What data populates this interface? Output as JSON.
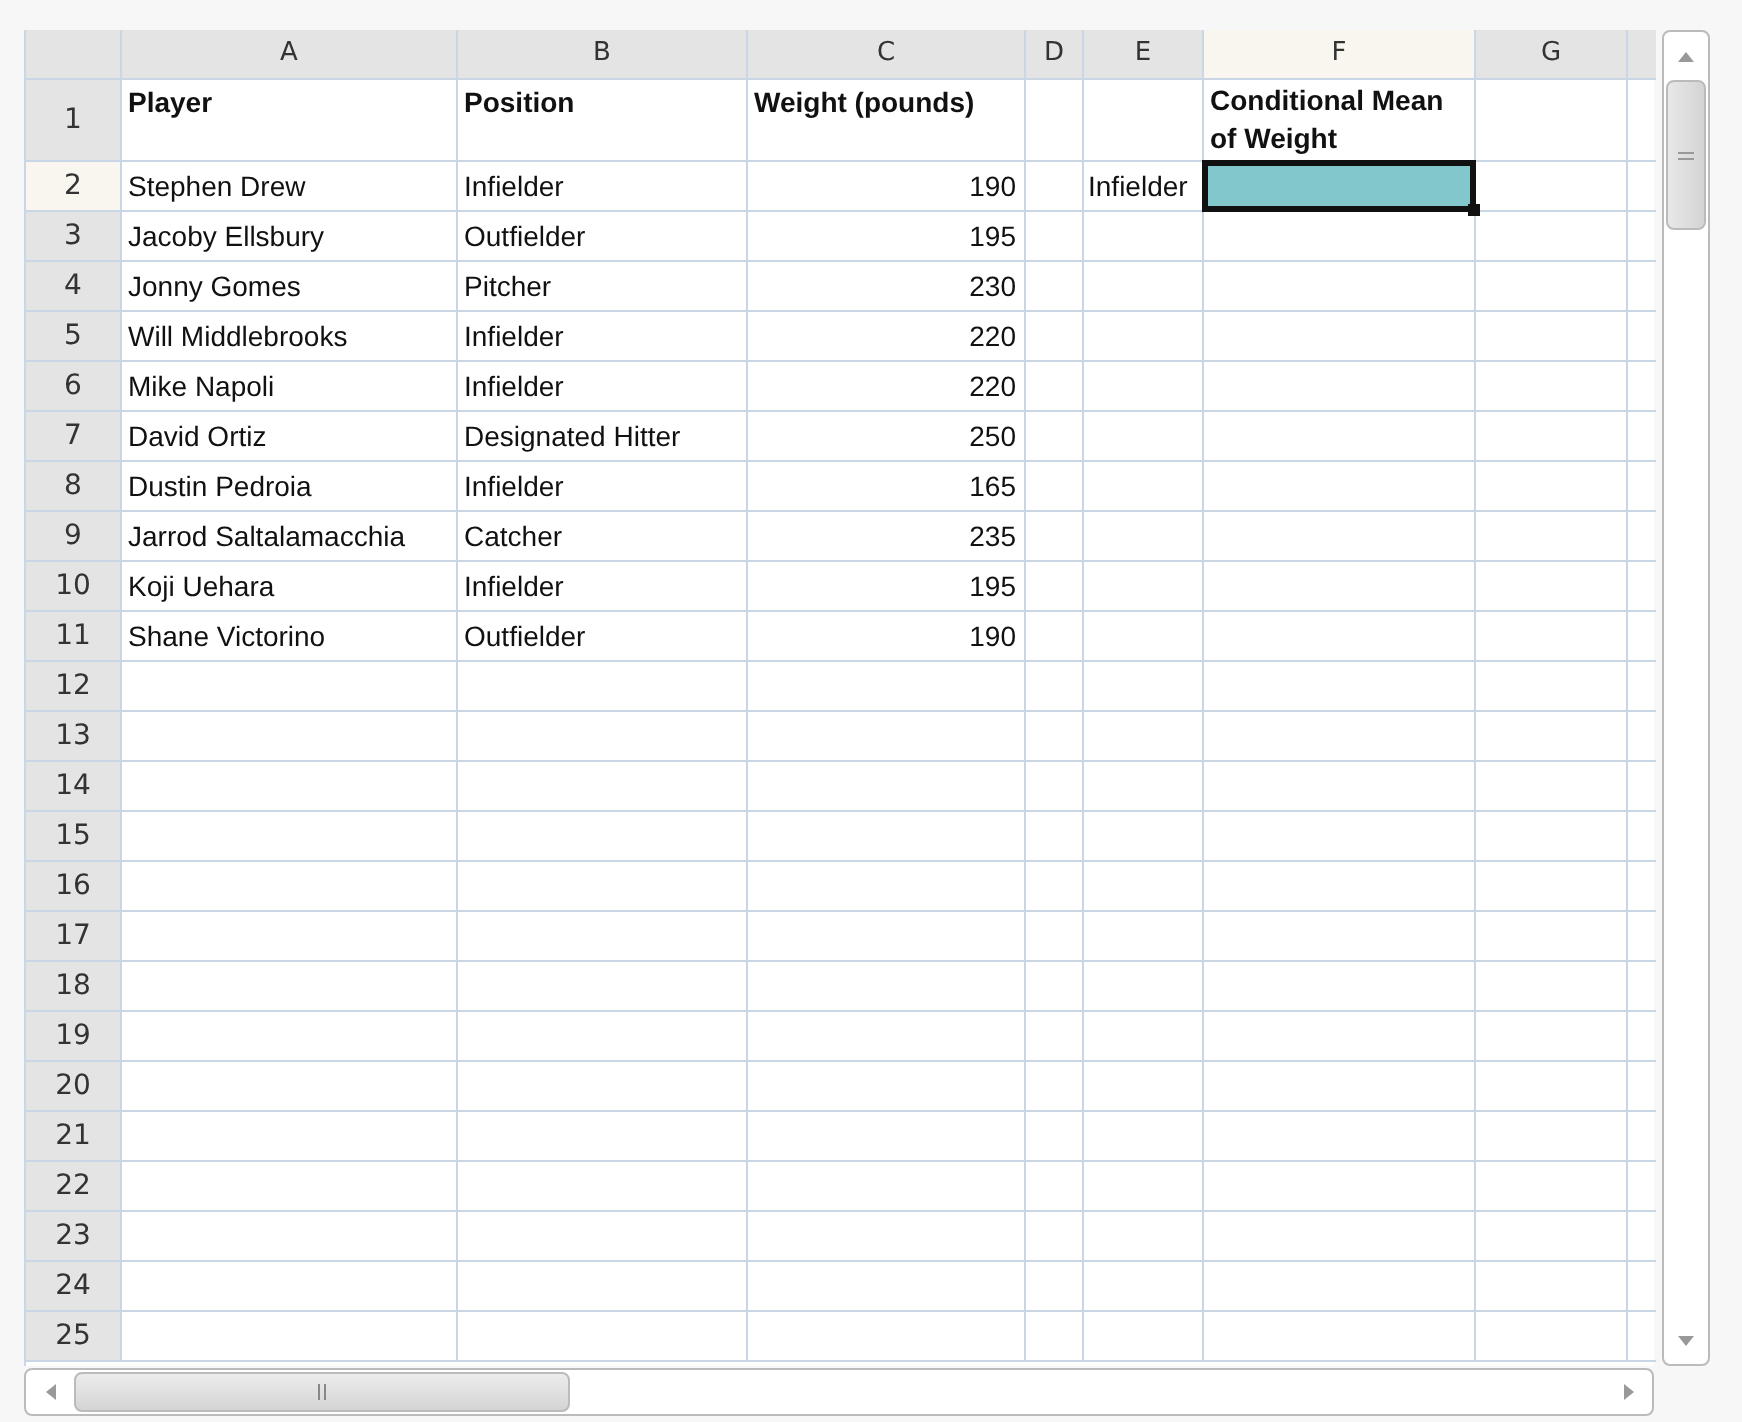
{
  "columns": [
    {
      "letter": "A",
      "selected": false
    },
    {
      "letter": "B",
      "selected": false
    },
    {
      "letter": "C",
      "selected": false
    },
    {
      "letter": "D",
      "selected": false
    },
    {
      "letter": "E",
      "selected": false
    },
    {
      "letter": "F",
      "selected": true
    },
    {
      "letter": "G",
      "selected": false
    }
  ],
  "header_row": {
    "number": "1",
    "player": "Player",
    "position": "Position",
    "weight": "Weight (pounds)",
    "mean_label": "Conditional Mean of Weight"
  },
  "rows": [
    {
      "number": "2",
      "selected": true,
      "player": "Stephen Drew",
      "position": "Infielder",
      "weight": "190",
      "criterion": "Infielder"
    },
    {
      "number": "3",
      "selected": false,
      "player": "Jacoby Ellsbury",
      "position": "Outfielder",
      "weight": "195"
    },
    {
      "number": "4",
      "selected": false,
      "player": "Jonny Gomes",
      "position": "Pitcher",
      "weight": "230"
    },
    {
      "number": "5",
      "selected": false,
      "player": "Will Middlebrooks",
      "position": "Infielder",
      "weight": "220"
    },
    {
      "number": "6",
      "selected": false,
      "player": "Mike Napoli",
      "position": "Infielder",
      "weight": "220"
    },
    {
      "number": "7",
      "selected": false,
      "player": "David Ortiz",
      "position": "Designated Hitter",
      "weight": "250"
    },
    {
      "number": "8",
      "selected": false,
      "player": "Dustin Pedroia",
      "position": "Infielder",
      "weight": "165"
    },
    {
      "number": "9",
      "selected": false,
      "player": "Jarrod Saltalamacchia",
      "position": "Catcher",
      "weight": "235"
    },
    {
      "number": "10",
      "selected": false,
      "player": "Koji Uehara",
      "position": "Infielder",
      "weight": "195"
    },
    {
      "number": "11",
      "selected": false,
      "player": "Shane Victorino",
      "position": "Outfielder",
      "weight": "190"
    },
    {
      "number": "12",
      "selected": false
    },
    {
      "number": "13",
      "selected": false
    },
    {
      "number": "14",
      "selected": false
    },
    {
      "number": "15",
      "selected": false
    },
    {
      "number": "16",
      "selected": false
    },
    {
      "number": "17",
      "selected": false
    },
    {
      "number": "18",
      "selected": false
    },
    {
      "number": "19",
      "selected": false
    },
    {
      "number": "20",
      "selected": false
    },
    {
      "number": "21",
      "selected": false
    },
    {
      "number": "22",
      "selected": false
    },
    {
      "number": "23",
      "selected": false
    },
    {
      "number": "24",
      "selected": false
    },
    {
      "number": "25",
      "selected": false
    }
  ]
}
